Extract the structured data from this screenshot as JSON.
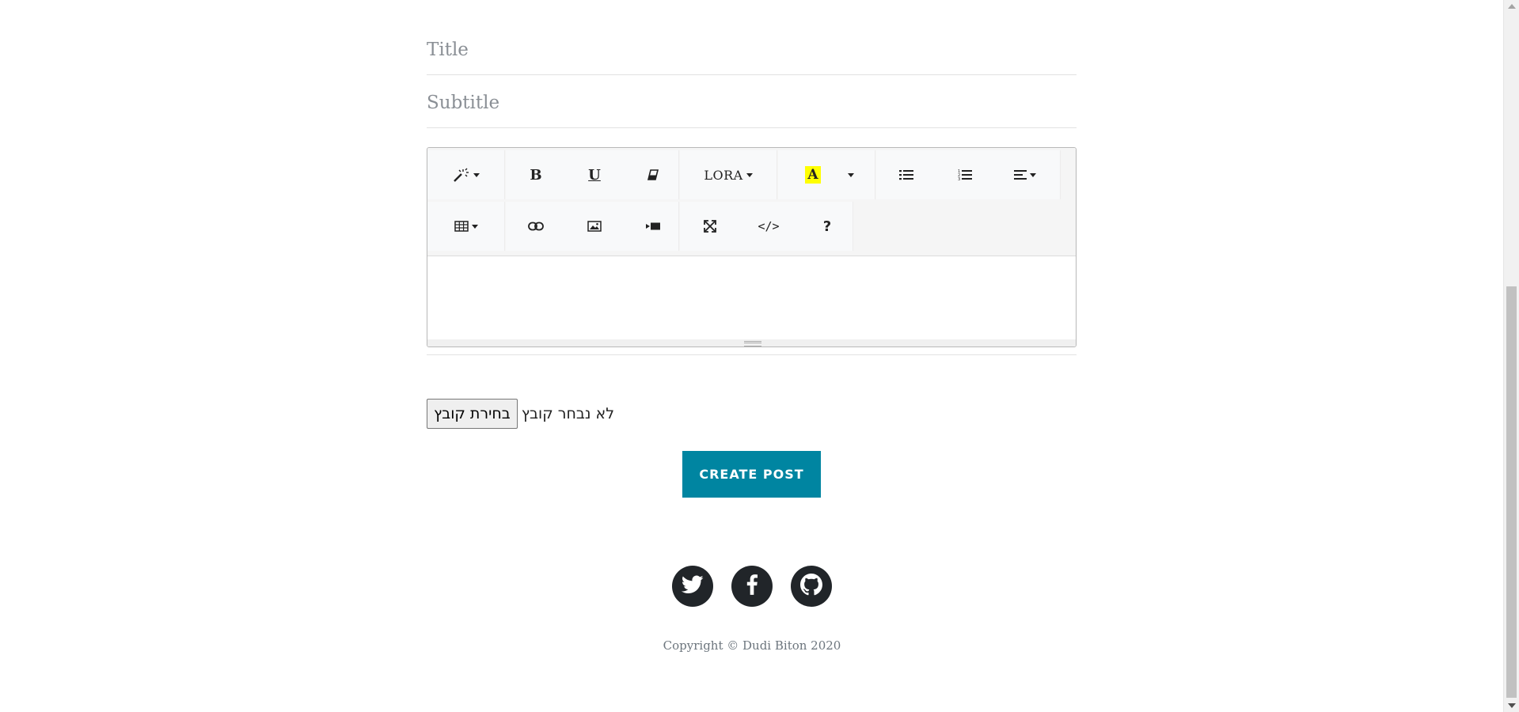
{
  "form": {
    "title_placeholder": "Title",
    "subtitle_placeholder": "Subtitle",
    "editor_content": ""
  },
  "toolbar": {
    "row1": {
      "style": {
        "icon": "magic-wand-icon"
      },
      "bold": {
        "label": "B"
      },
      "underline": {
        "label": "U"
      },
      "clear_format": {
        "icon": "eraser-icon"
      },
      "font_name": {
        "label": "LORA"
      },
      "color": {
        "label": "A",
        "highlight": "#ffff00"
      },
      "unordered_list": {
        "icon": "list-ul-icon"
      },
      "ordered_list": {
        "icon": "list-ol-icon"
      },
      "paragraph": {
        "icon": "align-left-icon"
      }
    },
    "row2": {
      "table": {
        "icon": "table-icon"
      },
      "link": {
        "icon": "link-icon"
      },
      "picture": {
        "icon": "picture-icon"
      },
      "video": {
        "icon": "video-icon"
      },
      "fullscreen": {
        "icon": "fullscreen-icon"
      },
      "codeview": {
        "label": "</>"
      },
      "help": {
        "label": "?"
      }
    }
  },
  "file_input": {
    "button_label": "בחירת קובץ",
    "status": "לא נבחר קובץ"
  },
  "submit": {
    "label": "Create Post"
  },
  "footer": {
    "social": [
      "twitter-icon",
      "facebook-icon",
      "github-icon"
    ],
    "copyright": "Copyright © Dudi Biton 2020"
  },
  "colors": {
    "accent": "#0085a1",
    "dark": "#212529",
    "muted": "#6c757d"
  }
}
